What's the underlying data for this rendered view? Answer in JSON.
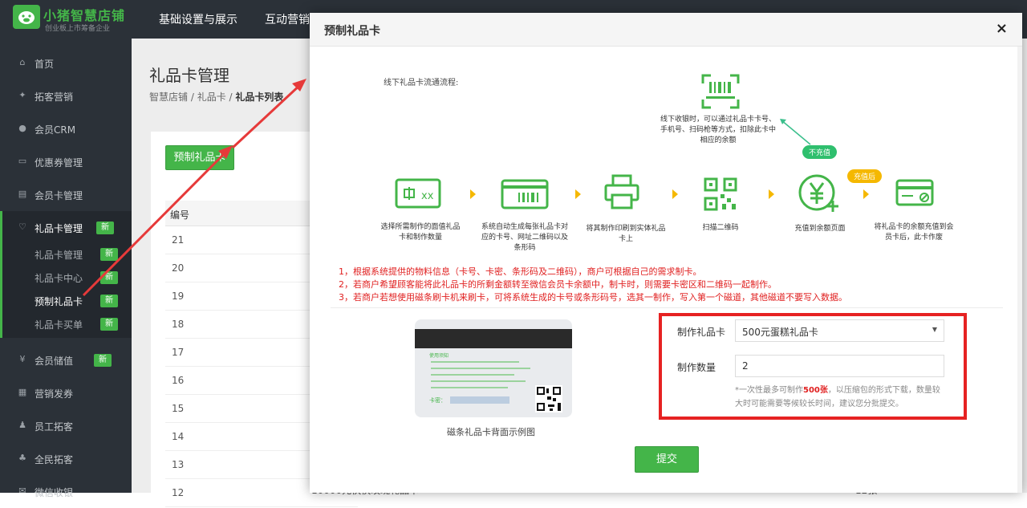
{
  "header": {
    "brand": "小猪智慧店铺",
    "brand_sub": "创业板上市筹备企业",
    "nav": [
      "基础设置与展示",
      "互动营销"
    ]
  },
  "sidebar": {
    "items": [
      {
        "label": "首页",
        "icon": "home-icon",
        "glyph": "⌂"
      },
      {
        "label": "拓客营销",
        "icon": "pin-icon",
        "glyph": "✦"
      },
      {
        "label": "会员CRM",
        "icon": "user-icon",
        "glyph": "●"
      },
      {
        "label": "优惠券管理",
        "icon": "coupon-icon",
        "glyph": "▭"
      },
      {
        "label": "会员卡管理",
        "icon": "card-icon",
        "glyph": "▤"
      },
      {
        "label": "礼品卡管理",
        "icon": "heart-icon",
        "glyph": "♡",
        "badge": "新"
      }
    ],
    "sub_items": [
      {
        "label": "礼品卡管理",
        "badge": "新"
      },
      {
        "label": "礼品卡中心",
        "badge": "新"
      },
      {
        "label": "预制礼品卡",
        "badge": "新"
      },
      {
        "label": "礼品卡买单",
        "badge": "新"
      }
    ],
    "items_after": [
      {
        "label": "会员储值",
        "icon": "yen-icon",
        "glyph": "¥",
        "badge": "新"
      },
      {
        "label": "营销发券",
        "icon": "ticket-icon",
        "glyph": "▦"
      },
      {
        "label": "员工拓客",
        "icon": "staff-icon",
        "glyph": "♟"
      },
      {
        "label": "全民拓客",
        "icon": "group-icon",
        "glyph": "♣"
      },
      {
        "label": "微信收银",
        "icon": "wechat-icon",
        "glyph": "✉"
      }
    ]
  },
  "main": {
    "title": "礼品卡管理",
    "breadcrumb": [
      "智慧店铺",
      "礼品卡",
      "礼品卡列表"
    ],
    "primary_button": "预制礼品卡",
    "table_header": "编号",
    "rows": [
      "21",
      "20",
      "19",
      "18",
      "17",
      "16",
      "15",
      "14",
      "13",
      "12"
    ],
    "last_row_name": "10000元快快玫瑰礼品卡",
    "last_row_count": "12张"
  },
  "modal": {
    "title": "预制礼品卡",
    "close": "×",
    "flow_caption": "线下礼品卡流通流程:",
    "steps": [
      "选择所需制作的面值礼品卡和制作数量",
      "系统自动生成每张礼品卡对应的卡号、网址二维码以及条形码",
      "将其制作印刷到实体礼品卡上",
      "扫描二维码",
      "充值到余额页面",
      "将礼品卡的余额充值到会员卡后，此卡作废"
    ],
    "offline_note": "线下收银时，可以通过礼品卡卡号、手机号、扫码枪等方式，扣除此卡中相应的余额",
    "tag_no_recharge": "不充值",
    "tag_after_recharge": "充值后",
    "card_value_text": "xx",
    "notes": [
      "1，根据系统提供的物料信息（卡号、卡密、条形码及二维码），商户可根据自己的需求制卡。",
      "2，若商户希望顾客能将此礼品卡的所剩金额转至微信会员卡余额中，制卡时，则需要卡密区和二维码一起制作。",
      "3，若商户若想使用磁条刷卡机来刷卡，可将系统生成的卡号或条形码号，选其一制作，写入第一个磁道，其他磁道不要写入数据。"
    ],
    "card_caption": "磁条礼品卡背面示例图",
    "card_notice_title": "使用须知",
    "card_no_label": "卡密：",
    "form": {
      "gift_card_label": "制作礼品卡",
      "gift_card_value": "500元蛋糕礼品卡",
      "qty_label": "制作数量",
      "qty_value": "2",
      "hint_pre": "*一次性最多可制作",
      "hint_max": "500张",
      "hint_post": "，以压缩包的形式下载，数量较大时可能需要等候较长时间，建议您分批提交。"
    },
    "submit": "提交"
  },
  "colors": {
    "brand_green": "#44b549",
    "sidebar_bg": "#2b3138",
    "annotation_red": "#e62222",
    "tag_yellow": "#f5b800"
  }
}
